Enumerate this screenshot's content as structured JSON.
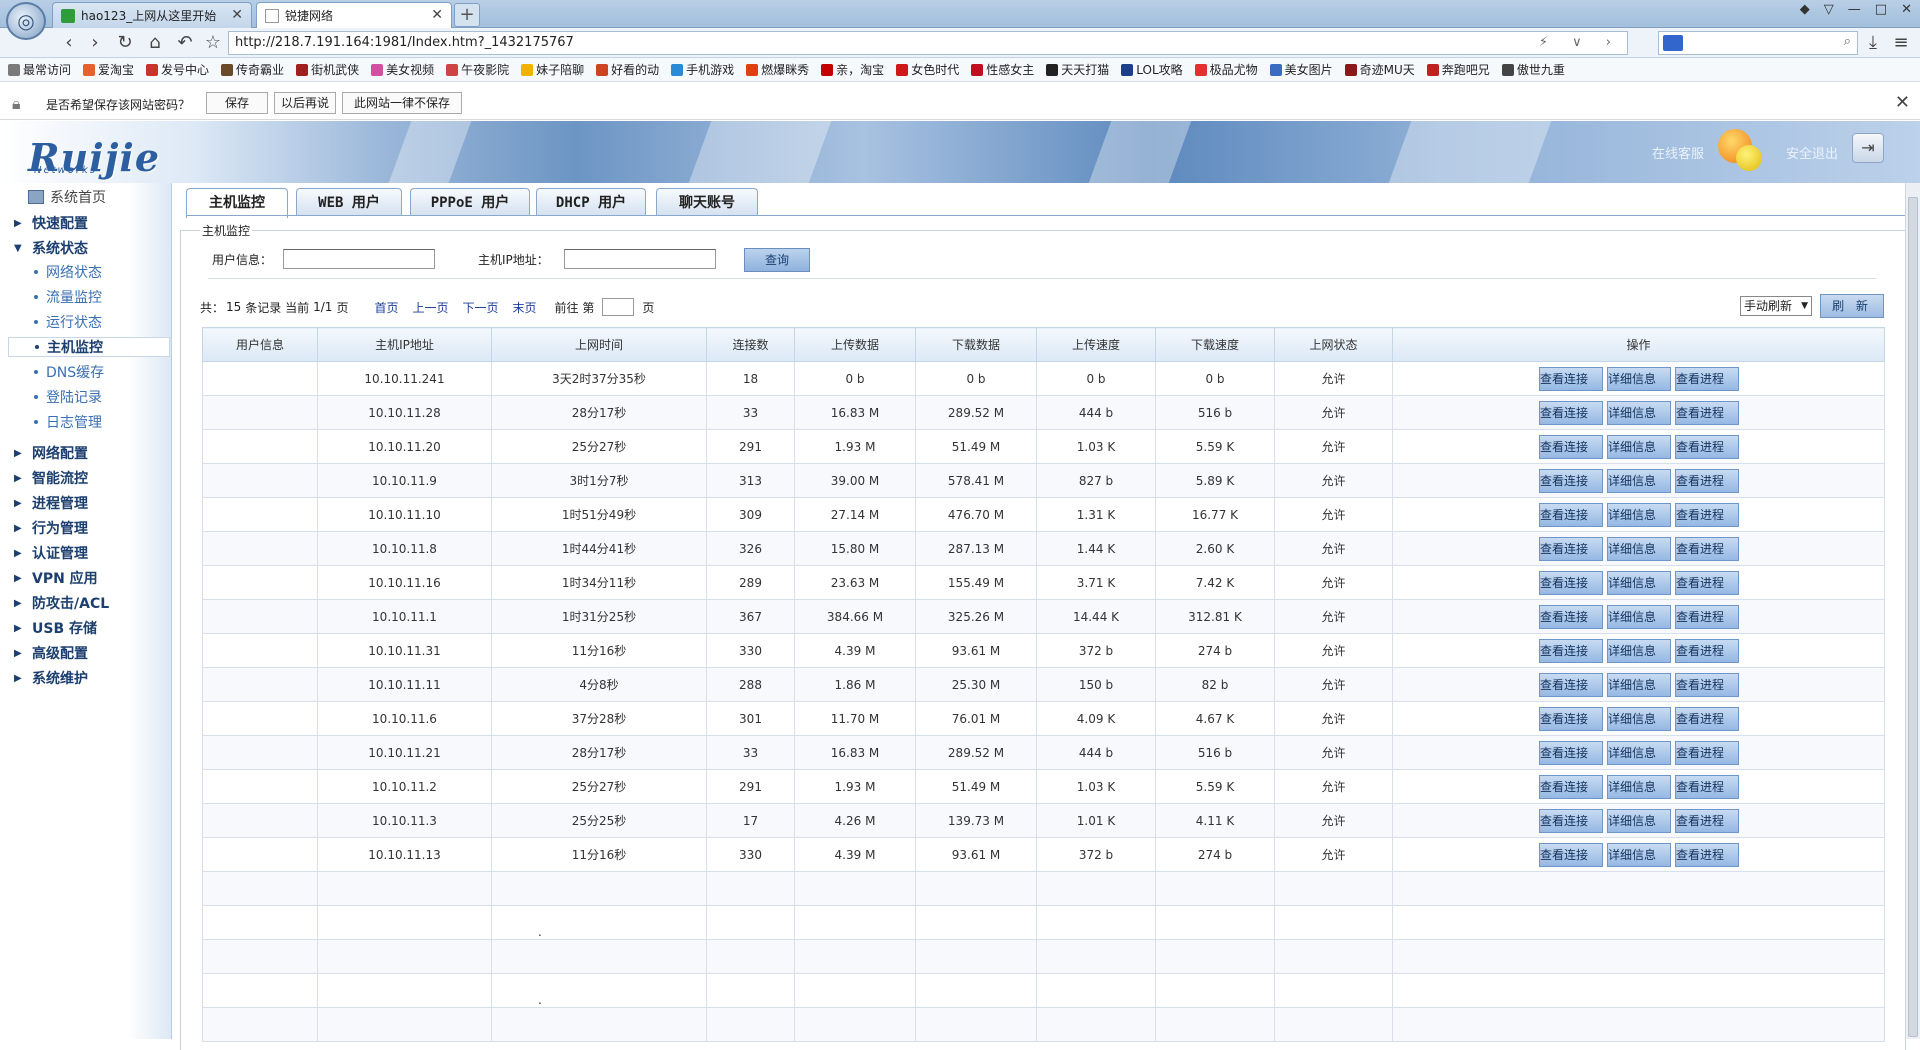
{
  "browser": {
    "tabs": [
      {
        "label": "hao123_上网从这里开始"
      },
      {
        "label": "锐捷网络"
      }
    ],
    "address": "http://218.7.191.164:1981/Index.htm?_1432175767",
    "bookmarks": [
      "最常访问",
      "爱淘宝",
      "发号中心",
      "传奇霸业",
      "街机武侠",
      "美女视频",
      "午夜影院",
      "妹子陪聊",
      "好看的动",
      "手机游戏",
      "燃爆眯秀",
      "亲，淘宝",
      "女色时代",
      "性感女主",
      "天天打猫",
      "LOL攻略",
      "极品尤物",
      "美女图片",
      "奇迹MU天",
      "奔跑吧兄",
      "傲世九重"
    ],
    "bookmark_colors": [
      "#7a7a7a",
      "#e8602c",
      "#c8342c",
      "#6b4a2a",
      "#a02020",
      "#d24fa2",
      "#c44",
      "#f0b400",
      "#c42",
      "#2a8ad4",
      "#e04010",
      "#c40000",
      "#d01818",
      "#c01020",
      "#222",
      "#1d3f8a",
      "#e03030",
      "#3a6cc0",
      "#8a1a1a",
      "#c02020",
      "#444"
    ],
    "password_prompt": "是否希望保存该网站密码？",
    "password_buttons": [
      "保存",
      "以后再说",
      "此网站一律不保存"
    ]
  },
  "header": {
    "logo": "Ruijie",
    "logo_sub": "Networks",
    "online_service": "在线客服",
    "logout": "安全退出"
  },
  "sidebar": {
    "home": "系统首页",
    "groups_top": [
      "快速配置"
    ],
    "expanded_group": "系统状态",
    "sub_items": [
      "网络状态",
      "流量监控",
      "运行状态",
      "主机监控",
      "DNS缓存",
      "登陆记录",
      "日志管理"
    ],
    "active_sub": "主机监控",
    "groups_bottom": [
      "网络配置",
      "智能流控",
      "进程管理",
      "行为管理",
      "认证管理",
      "VPN 应用",
      "防攻击/ACL",
      "USB 存储",
      "高级配置",
      "系统维护"
    ]
  },
  "content": {
    "tabs": [
      "主机监控",
      "WEB 用户",
      "PPPoE 用户",
      "DHCP 用户",
      "聊天账号"
    ],
    "legend": "主机监控",
    "user_info_label": "用户信息：",
    "host_ip_label": "主机IP地址：",
    "query_button": "查询",
    "pager": {
      "total_prefix": "共：",
      "total": "15",
      "total_suffix": "条记录 当前",
      "page": "1/1",
      "page_suffix": "页",
      "first": "首页",
      "prev": "上一页",
      "next": "下一页",
      "last": "末页",
      "goto_prefix": "前往 第",
      "goto_suffix": "页"
    },
    "refresh_mode": "手动刷新",
    "refresh_button": "刷 新"
  },
  "table": {
    "columns": [
      "用户信息",
      "主机IP地址",
      "上网时间",
      "连接数",
      "上传数据",
      "下载数据",
      "上传速度",
      "下载速度",
      "上网状态",
      "操作"
    ],
    "action_labels": [
      "查看连接",
      "详细信息",
      "查看进程"
    ],
    "rows": [
      [
        "",
        "10.10.11.241",
        "3天2时37分35秒",
        "18",
        "0 b",
        "0 b",
        "0 b",
        "0 b",
        "允许"
      ],
      [
        "",
        "10.10.11.28",
        "28分17秒",
        "33",
        "16.83 M",
        "289.52 M",
        "444 b",
        "516 b",
        "允许"
      ],
      [
        "",
        "10.10.11.20",
        "25分27秒",
        "291",
        "1.93 M",
        "51.49 M",
        "1.03 K",
        "5.59 K",
        "允许"
      ],
      [
        "",
        "10.10.11.9",
        "3时1分7秒",
        "313",
        "39.00 M",
        "578.41 M",
        "827 b",
        "5.89 K",
        "允许"
      ],
      [
        "",
        "10.10.11.10",
        "1时51分49秒",
        "309",
        "27.14 M",
        "476.70 M",
        "1.31 K",
        "16.77 K",
        "允许"
      ],
      [
        "",
        "10.10.11.8",
        "1时44分41秒",
        "326",
        "15.80 M",
        "287.13 M",
        "1.44 K",
        "2.60 K",
        "允许"
      ],
      [
        "",
        "10.10.11.16",
        "1时34分11秒",
        "289",
        "23.63 M",
        "155.49 M",
        "3.71 K",
        "7.42 K",
        "允许"
      ],
      [
        "",
        "10.10.11.1",
        "1时31分25秒",
        "367",
        "384.66 M",
        "325.26 M",
        "14.44 K",
        "312.81 K",
        "允许"
      ],
      [
        "",
        "10.10.11.31",
        "11分16秒",
        "330",
        "4.39 M",
        "93.61 M",
        "372 b",
        "274 b",
        "允许"
      ],
      [
        "",
        "10.10.11.11",
        "4分8秒",
        "288",
        "1.86 M",
        "25.30 M",
        "150 b",
        "82 b",
        "允许"
      ],
      [
        "",
        "10.10.11.6",
        "37分28秒",
        "301",
        "11.70 M",
        "76.01 M",
        "4.09 K",
        "4.67 K",
        "允许"
      ],
      [
        "",
        "10.10.11.21",
        "28分17秒",
        "33",
        "16.83 M",
        "289.52 M",
        "444 b",
        "516 b",
        "允许"
      ],
      [
        "",
        "10.10.11.2",
        "25分27秒",
        "291",
        "1.93 M",
        "51.49 M",
        "1.03 K",
        "5.59 K",
        "允许"
      ],
      [
        "",
        "10.10.11.3",
        "25分25秒",
        "17",
        "4.26 M",
        "139.73 M",
        "1.01 K",
        "4.11 K",
        "允许"
      ],
      [
        "",
        "10.10.11.13",
        "11分16秒",
        "330",
        "4.39 M",
        "93.61 M",
        "372 b",
        "274 b",
        "允许"
      ]
    ],
    "empty_rows": [
      [
        "",
        "",
        "",
        "",
        "",
        "",
        "",
        "",
        "",
        ""
      ],
      [
        "",
        "",
        ".",
        "",
        "",
        "",
        "",
        "",
        "",
        ""
      ],
      [
        "",
        "",
        "",
        "",
        "",
        "",
        "",
        "",
        "",
        ""
      ],
      [
        "",
        "",
        ".",
        "",
        "",
        "",
        "",
        "",
        "",
        ""
      ],
      [
        "",
        "",
        "",
        "",
        "",
        "",
        "",
        "",
        "",
        ""
      ]
    ]
  }
}
